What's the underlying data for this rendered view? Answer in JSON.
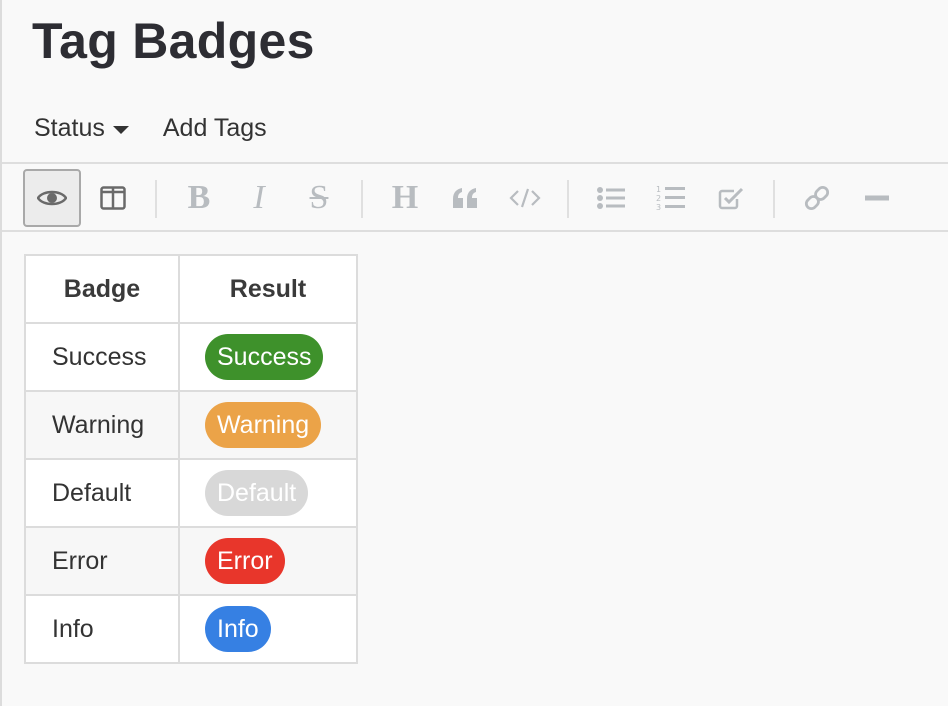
{
  "page": {
    "title": "Tag Badges"
  },
  "menu": {
    "items": [
      {
        "label": "Status",
        "has_dropdown": true
      },
      {
        "label": "Add Tags",
        "has_dropdown": false
      }
    ]
  },
  "toolbar": {
    "buttons": [
      {
        "name": "preview",
        "icon": "eye-icon",
        "active": true
      },
      {
        "name": "side-by-side",
        "icon": "columns-icon",
        "active": false
      },
      {
        "name": "bold",
        "icon": "bold-icon",
        "glyph": "B",
        "active": false
      },
      {
        "name": "italic",
        "icon": "italic-icon",
        "glyph": "I",
        "active": false
      },
      {
        "name": "strikethrough",
        "icon": "strikethrough-icon",
        "glyph": "S",
        "active": false
      },
      {
        "name": "heading",
        "icon": "heading-icon",
        "glyph": "H",
        "active": false
      },
      {
        "name": "quote",
        "icon": "quote-icon",
        "active": false
      },
      {
        "name": "code",
        "icon": "code-icon",
        "glyph": "</>",
        "active": false
      },
      {
        "name": "unordered-list",
        "icon": "bullet-list-icon",
        "active": false
      },
      {
        "name": "ordered-list",
        "icon": "numbered-list-icon",
        "active": false
      },
      {
        "name": "checklist",
        "icon": "checkbox-icon",
        "active": false
      },
      {
        "name": "link",
        "icon": "link-icon",
        "active": false
      },
      {
        "name": "horizontal-rule",
        "icon": "minus-icon",
        "active": false
      }
    ]
  },
  "table": {
    "headers": [
      "Badge",
      "Result"
    ],
    "rows": [
      {
        "name": "Success",
        "badge": "Success",
        "color": "#3e912b"
      },
      {
        "name": "Warning",
        "badge": "Warning",
        "color": "#eba348"
      },
      {
        "name": "Default",
        "badge": "Default",
        "color": "#d8d8d8"
      },
      {
        "name": "Error",
        "badge": "Error",
        "color": "#e8362b"
      },
      {
        "name": "Info",
        "badge": "Info",
        "color": "#3680e3"
      }
    ]
  }
}
